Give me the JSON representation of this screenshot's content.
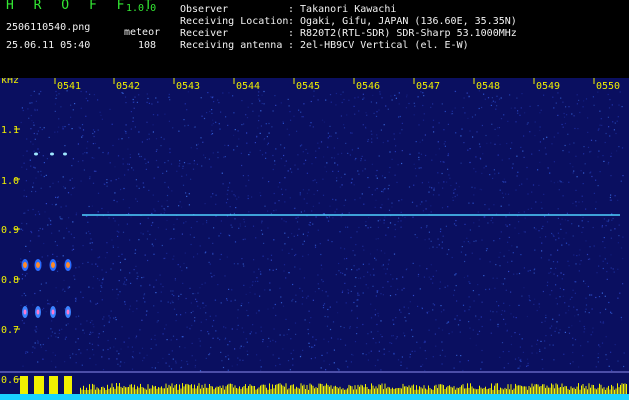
{
  "header": {
    "app_name": "H R O F F T",
    "version": "1.0.0",
    "filename": "2506110540.png",
    "mode": "meteor",
    "datetime": "25.06.11 05:40",
    "count": "108",
    "info": [
      {
        "label": "Observer",
        "value": ": Takanori Kawachi"
      },
      {
        "label": "Receiving Location",
        "value": ": Ogaki, Gifu, JAPAN (136.60E, 35.35N)"
      },
      {
        "label": "Receiver",
        "value": ": R820T2(RTL-SDR) SDR-Sharp 53.1000MHz"
      },
      {
        "label": "Receiving antenna",
        "value": ": 2el-HB9CV Vertical (el. E-W)"
      }
    ]
  },
  "spectrogram": {
    "y_unit": "kHz",
    "y_ticks": [
      "1.1",
      "1.0",
      "0.9",
      "0.8",
      "0.7",
      "0.6"
    ],
    "x_ticks": [
      "0541",
      "0542",
      "0543",
      "0544",
      "0545",
      "0546",
      "0547",
      "0548",
      "0549",
      "0550"
    ],
    "colors": {
      "background": "#0a0f60",
      "axis_text": "#f0f000",
      "carrier": "#4fd2ff",
      "level_bar": "#f0f000",
      "level_base": "#19d2ff"
    }
  }
}
